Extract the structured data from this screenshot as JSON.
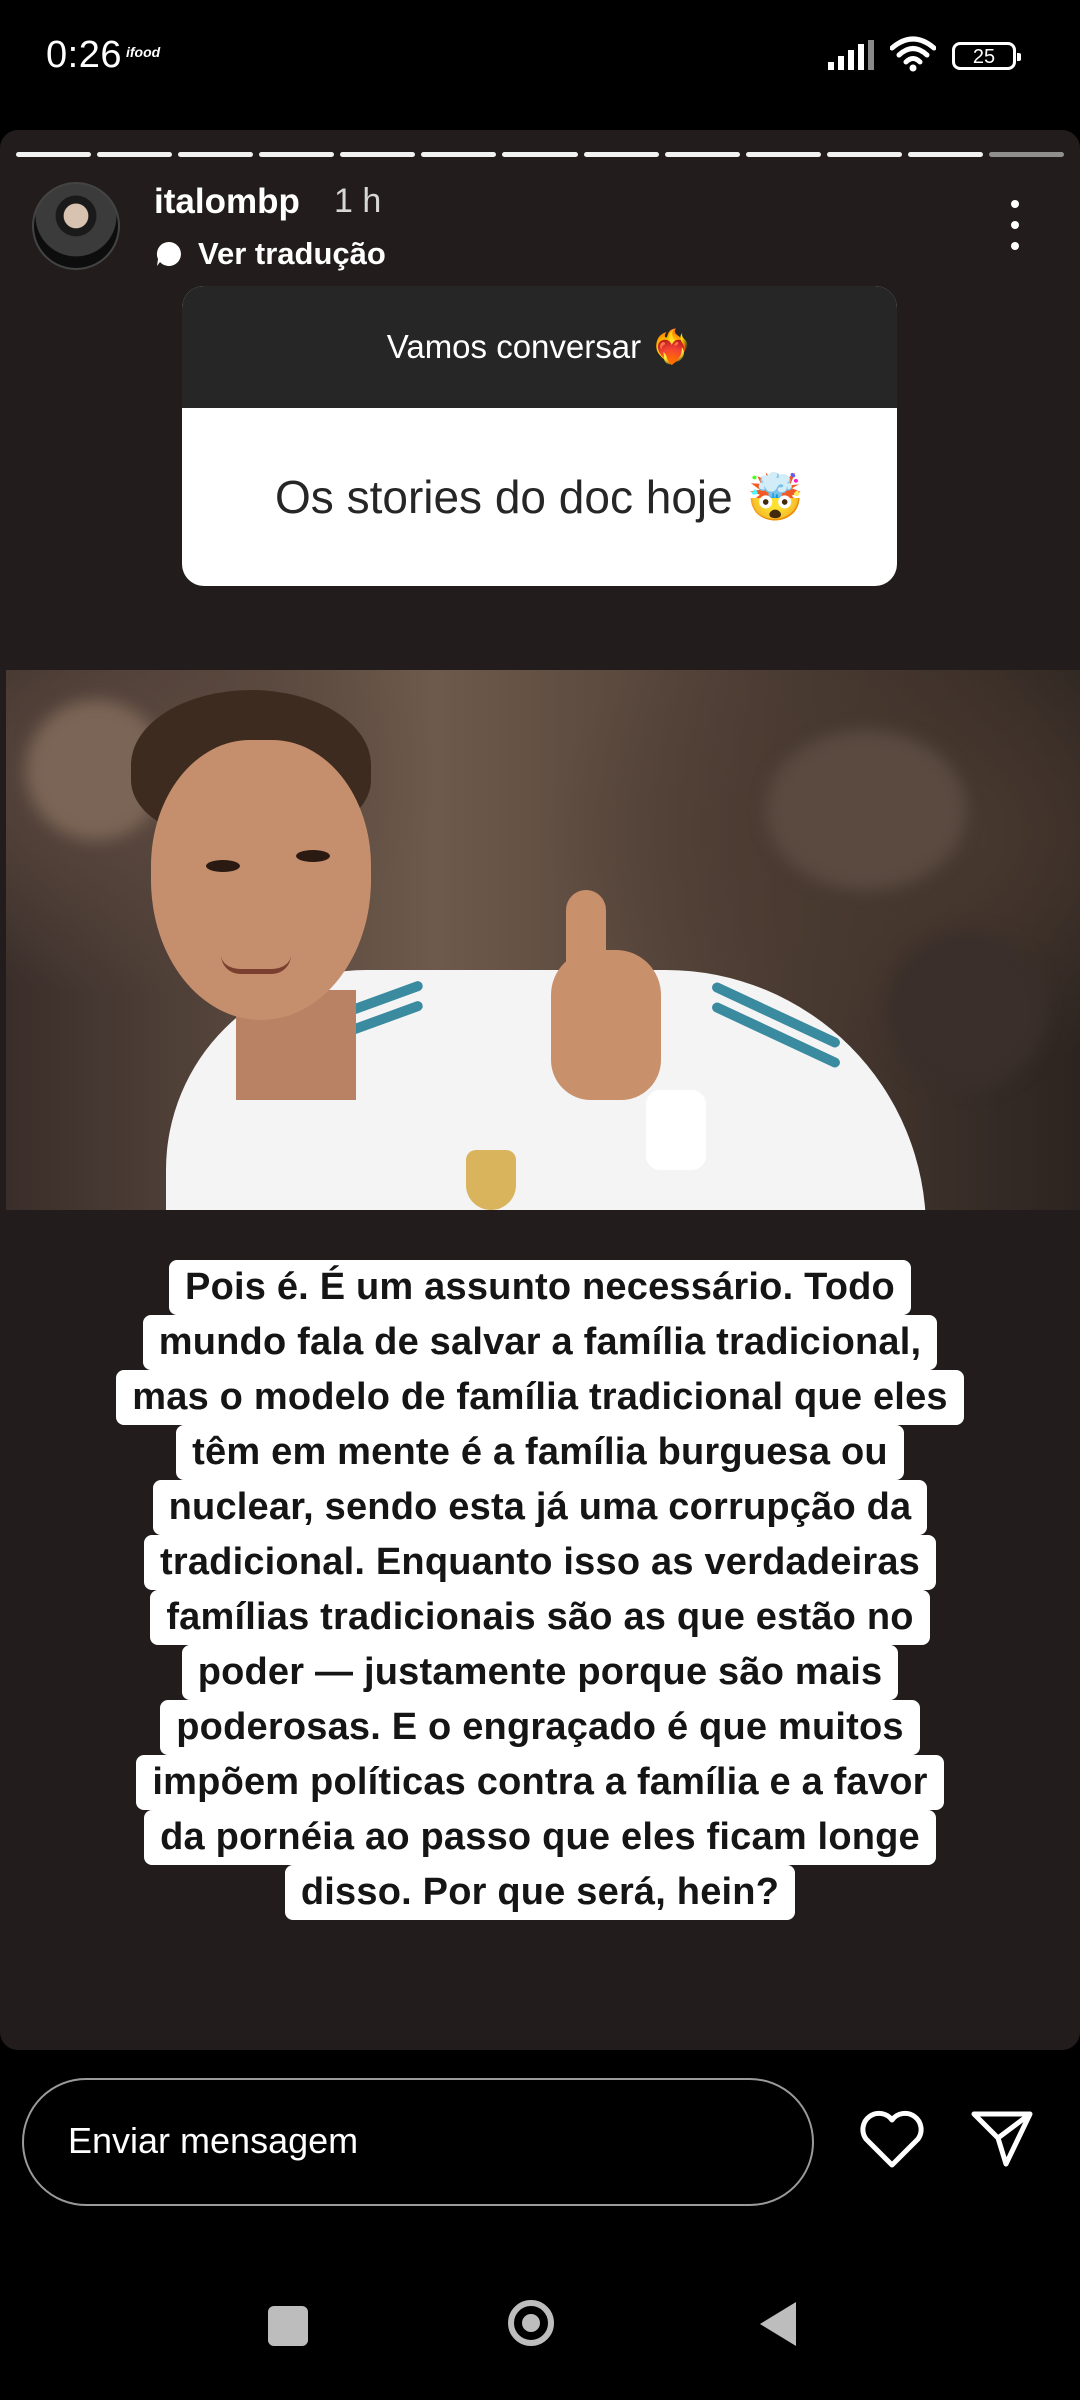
{
  "status_bar": {
    "time": "0:26",
    "notification_app": "ifood",
    "battery_level": "25"
  },
  "story": {
    "progress_segments_total": 13,
    "progress_segments_viewed": 12,
    "author": {
      "username": "italombp",
      "time_ago": "1 h"
    },
    "translate_label": "Ver tradução",
    "question_sticker": {
      "prompt": "Vamos conversar",
      "prompt_emoji": "❤️‍🔥",
      "answer": "Os stories do doc hoje",
      "answer_emoji": "🤯"
    },
    "photo_description_icon": "football-player-photo",
    "text_lines": [
      "Pois é. É um assunto necessário. Todo",
      "mundo fala de salvar a família tradicional,",
      "mas o modelo de família tradicional que eles",
      "têm em mente é a família burguesa ou",
      "nuclear, sendo esta já uma corrupção da",
      "tradicional. Enquanto isso as verdadeiras",
      "famílias tradicionais são as que estão no",
      "poder — justamente porque são mais",
      "poderosas. E o engraçado é que muitos",
      "impõem políticas contra a família e a favor",
      "da pornéia ao passo que eles ficam longe",
      "disso. Por que será, hein?"
    ]
  },
  "reply_bar": {
    "placeholder": "Enviar mensagem"
  },
  "icons": {
    "like": "heart-icon",
    "share": "send-icon",
    "menu": "more-vertical-icon"
  },
  "colors": {
    "story_background": "#221c1c",
    "sticker_header": "#262626",
    "text_highlight": "#ffffff"
  }
}
